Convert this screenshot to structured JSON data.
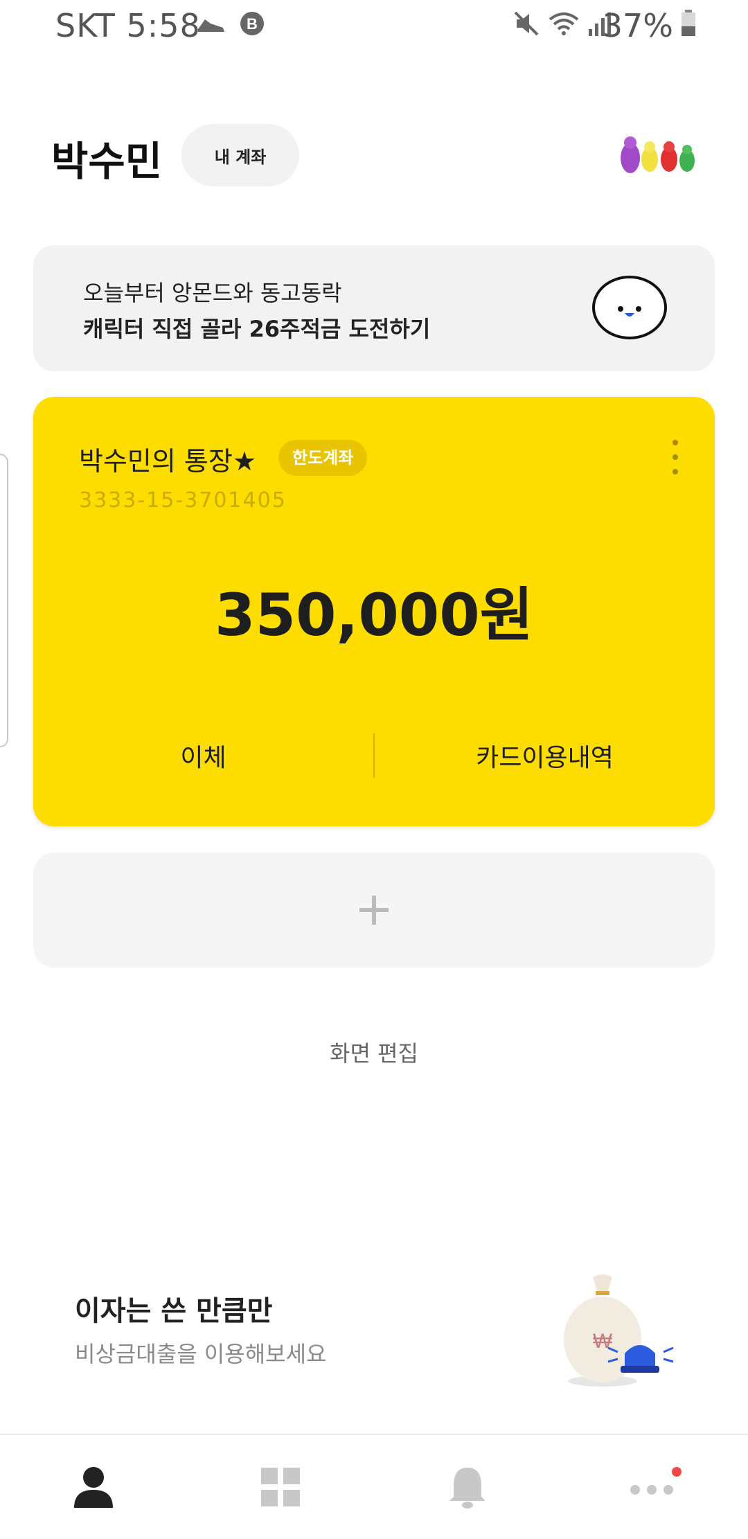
{
  "status_bar": {
    "left_text": "SKT 5:58",
    "battery_text": "37%"
  },
  "header": {
    "owner_name": "박수민",
    "my_account_label": "내 계좌"
  },
  "promo": {
    "line1": "오늘부터 앙몬드와 동고동락",
    "line2": "캐릭터 직접 골라 26주적금 도전하기"
  },
  "account_card": {
    "title": "박수민의 통장★",
    "badge": "한도계좌",
    "account_number": "3333-15-3701405",
    "balance": "350,000원",
    "transfer_label": "이체",
    "card_history_label": "카드이용내역",
    "color": "#fddd00"
  },
  "edit_screen_label": "화면 편집",
  "loan_ad": {
    "title": "이자는 쓴 만큼만",
    "subtitle": "비상금대출을 이용해보세요"
  },
  "bottom_nav": {
    "items": [
      "person-icon",
      "grid-icon",
      "bell-icon",
      "more-icon"
    ],
    "notification_dot_color": "#f04848"
  }
}
